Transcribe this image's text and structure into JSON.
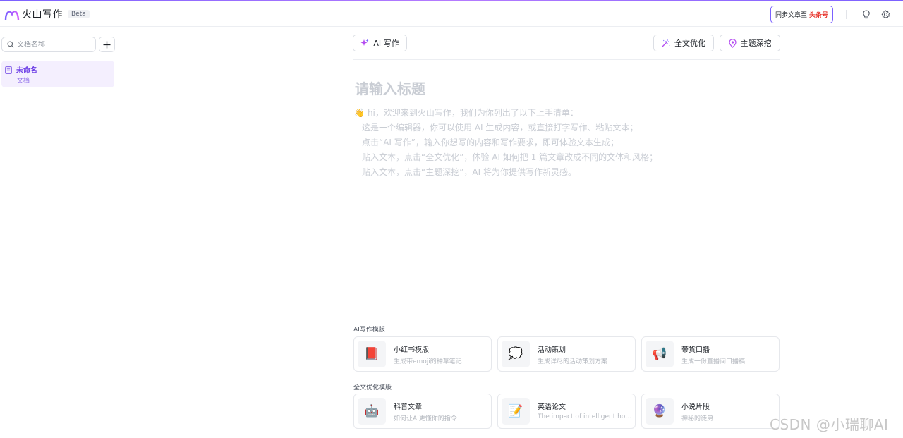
{
  "header": {
    "app_name": "火山写作",
    "beta_label": "Beta",
    "sync_label": "同步文章至",
    "sync_brand": "头条号",
    "icons": [
      "lightbulb-icon",
      "settings-icon"
    ]
  },
  "sidebar": {
    "search_placeholder": "文档名称",
    "add_label": "+",
    "documents": [
      {
        "title": "未命名",
        "type": "文档"
      }
    ]
  },
  "toolbar": {
    "ai_write": "AI 写作",
    "full_optimize": "全文优化",
    "topic_explore": "主题深挖"
  },
  "editor": {
    "title_placeholder": "请输入标题",
    "intro_emoji": "👋",
    "intro_lines": [
      "hi，欢迎来到火山写作，我们为你列出了以下上手清单：",
      "这是一个编辑器，你可以使用 AI 生成内容，或直接打字写作、粘贴文本；",
      "点击“AI 写作”，输入你想写的内容和写作要求，即可体验文本生成；",
      "贴入文本，点击“全文优化”，体验 AI 如何把 1 篇文章改成不同的文体和风格；",
      "贴入文本，点击“主题深挖”，AI 将为你提供写作新灵感。"
    ]
  },
  "templates": {
    "ai_section_label": "AI写作模版",
    "ai": [
      {
        "icon": "📕",
        "icon_name": "red-book-icon",
        "name": "小红书模版",
        "desc": "生成带emoji的种草笔记"
      },
      {
        "icon": "💭",
        "icon_name": "speech-bubble-icon",
        "name": "活动策划",
        "desc": "生成详尽的活动策划方案"
      },
      {
        "icon": "📢",
        "icon_name": "megaphone-icon",
        "name": "带货口播",
        "desc": "生成一份直播间口播稿"
      }
    ],
    "optimize_section_label": "全文优化模版",
    "optimize": [
      {
        "icon": "🤖",
        "icon_name": "robot-icon",
        "name": "科普文章",
        "desc": "如何让AI更懂你的指令"
      },
      {
        "icon": "📝",
        "icon_name": "memo-icon",
        "name": "英语论文",
        "desc": "The impact of intelligent hou…"
      },
      {
        "icon": "🔮",
        "icon_name": "crystal-ball-icon",
        "name": "小说片段",
        "desc": "神秘的徒弟"
      }
    ]
  },
  "watermark": "CSDN @小瑞聊AI",
  "colors": {
    "accent": "#7b61ff",
    "selected_bg": "#f4effe",
    "selected_text": "#6d3fe6",
    "brand_red": "#e7332a",
    "placeholder": "#c9cdd4"
  }
}
